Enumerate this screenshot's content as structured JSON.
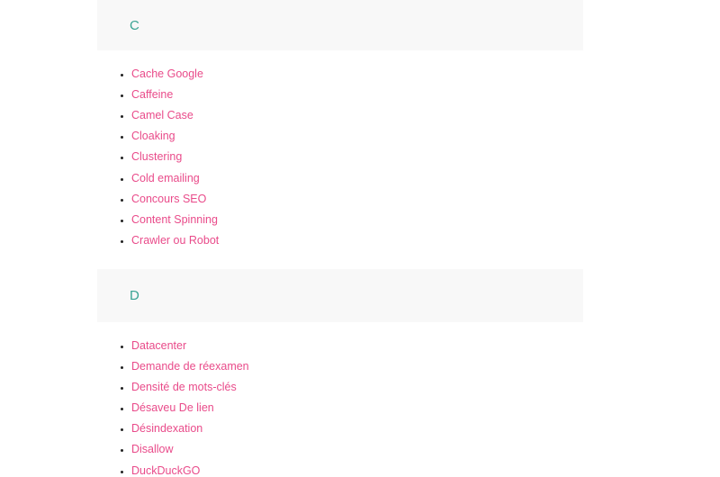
{
  "sections": [
    {
      "letter": "C",
      "terms": [
        "Cache Google",
        "Caffeine",
        "Camel Case",
        "Cloaking",
        "Clustering",
        "Cold emailing",
        "Concours SEO",
        "Content Spinning",
        "Crawler ou Robot"
      ]
    },
    {
      "letter": "D",
      "terms": [
        "Datacenter",
        "Demande de réexamen",
        "Densité de mots-clés",
        "Désaveu De lien",
        "Désindexation",
        "Disallow",
        "DuckDuckGO"
      ]
    }
  ],
  "colors": {
    "letter": "#3aa393",
    "link": "#e94b8a",
    "header_bg": "#f8f8f8"
  }
}
